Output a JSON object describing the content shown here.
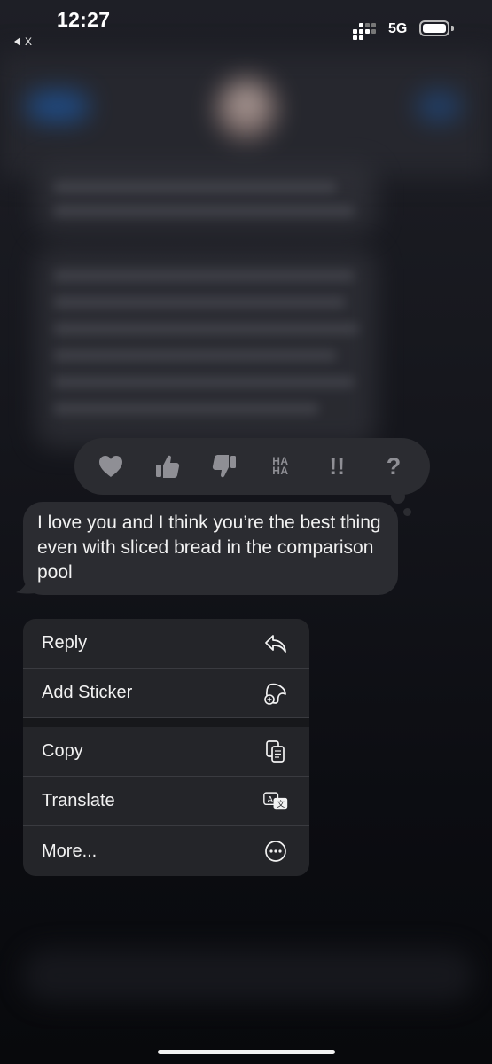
{
  "status_bar": {
    "time": "12:27",
    "back_label": "X",
    "network": "5G"
  },
  "tapbacks": [
    {
      "name": "heart",
      "icon": "heart-icon"
    },
    {
      "name": "thumbs-up",
      "icon": "thumbs-up-icon"
    },
    {
      "name": "thumbs-down",
      "icon": "thumbs-down-icon"
    },
    {
      "name": "haha",
      "label_top": "HA",
      "label_bottom": "HA"
    },
    {
      "name": "emphasize",
      "label": "!!"
    },
    {
      "name": "question",
      "label": "?"
    }
  ],
  "message": {
    "text": "I love you and I think you’re the best thing even with sliced bread in the comparison pool"
  },
  "menu": {
    "reply": {
      "label": "Reply",
      "icon": "reply-icon"
    },
    "add_sticker": {
      "label": "Add Sticker",
      "icon": "sticker-add-icon"
    },
    "copy": {
      "label": "Copy",
      "icon": "copy-icon"
    },
    "translate": {
      "label": "Translate",
      "icon": "translate-icon"
    },
    "more": {
      "label": "More...",
      "icon": "ellipsis-circle-icon"
    }
  },
  "colors": {
    "bubble": "#2b2c31",
    "menu": "#242529",
    "icon_gray": "#8f8f95"
  }
}
